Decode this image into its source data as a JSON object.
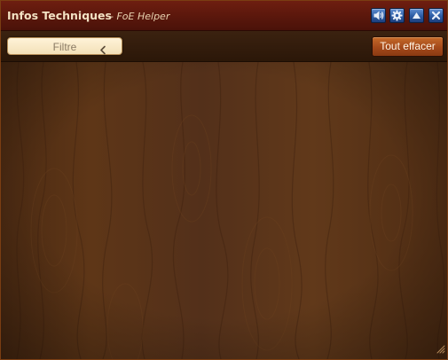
{
  "window": {
    "title": "Infos Techniques",
    "subtitle": "- FoE Helper",
    "buttons": [
      {
        "name": "sound-icon"
      },
      {
        "name": "gear-icon"
      },
      {
        "name": "minimize-up-icon"
      },
      {
        "name": "close-icon"
      }
    ]
  },
  "toolbar": {
    "filter_label": "Filtre",
    "clear_all_label": "Tout effacer"
  },
  "content": {
    "entries": []
  },
  "colors": {
    "titlebar": "#5a170c",
    "title_text": "#f3e2c4",
    "window_button": "#2f5fa8",
    "clear_button": "#a4491a",
    "wood_background": "#5a3418"
  }
}
